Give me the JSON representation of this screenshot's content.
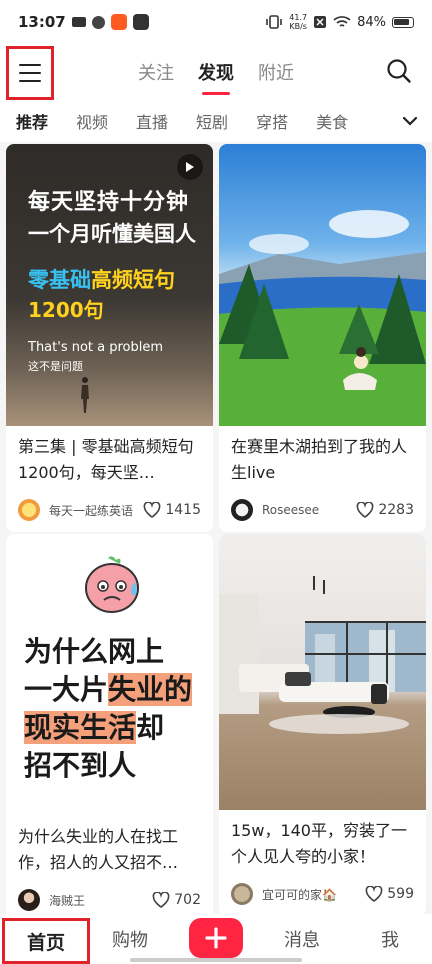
{
  "status_bar": {
    "time": "13:07",
    "net_speed_top": "41.7",
    "net_speed_unit": "KB/s",
    "battery": "84%"
  },
  "header": {
    "tabs": [
      {
        "label": "关注"
      },
      {
        "label": "发现"
      },
      {
        "label": "附近"
      }
    ],
    "active_tab": "发现"
  },
  "categories": [
    {
      "label": "推荐"
    },
    {
      "label": "视频"
    },
    {
      "label": "直播"
    },
    {
      "label": "短剧"
    },
    {
      "label": "穿搭"
    },
    {
      "label": "美食"
    }
  ],
  "active_category": "推荐",
  "feed": {
    "cards": [
      {
        "cover_text": {
          "line1": "每天坚持十分钟",
          "line2": "一个月听懂美国人",
          "line3a": "零基础",
          "line3b": "高频短句",
          "line4": "1200句",
          "line5": "That's not a problem",
          "line6": "这不是问题"
        },
        "title": "第三集 | 零基础高频短句1200句，每天坚…",
        "author": "每天一起练英语",
        "likes": "1415"
      },
      {
        "title": "在赛里木湖拍到了我的人生live",
        "author": "Roseesee",
        "likes": "2283"
      },
      {
        "cover_text": {
          "line1": "为什么网上",
          "line2a": "一大片",
          "line2b": "失业的",
          "line3a": "现实生活",
          "line3b": "却",
          "line4": "招不到人"
        },
        "title": "为什么失业的人在找工作，招人的人又招不…",
        "author": "海贼王",
        "likes": "702"
      },
      {
        "title": "15w，140平，穷装了一个人见人夸的小家！",
        "author": "宜可可的家🏠",
        "likes": "599"
      }
    ]
  },
  "bottom_nav": {
    "home": "首页",
    "shop": "购物",
    "messages": "消息",
    "me": "我"
  },
  "colors": {
    "accent": "#ff2442",
    "highlight_box": "#e0232a"
  }
}
